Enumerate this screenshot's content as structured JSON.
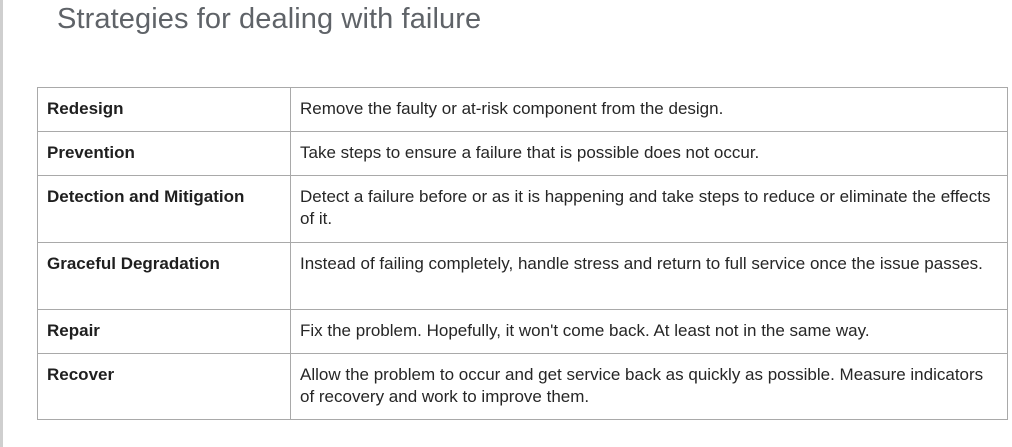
{
  "title": "Strategies for dealing with failure",
  "rows": [
    {
      "term": "Redesign",
      "description": "Remove the faulty or at-risk component from the design."
    },
    {
      "term": "Prevention",
      "description": "Take steps to ensure a failure that is possible does not occur."
    },
    {
      "term": "Detection and Mitigation",
      "description": "Detect a failure before or as it is happening and take steps to reduce or eliminate the effects of it."
    },
    {
      "term": "Graceful Degradation",
      "description": "Instead of failing completely, handle stress and return to full service once the issue passes."
    },
    {
      "term": "Repair",
      "description": "Fix the problem. Hopefully, it won't come back. At least not in the same way."
    },
    {
      "term": "Recover",
      "description": "Allow the problem to occur and get service back as quickly as possible. Measure indicators of recovery and work to improve them."
    }
  ]
}
